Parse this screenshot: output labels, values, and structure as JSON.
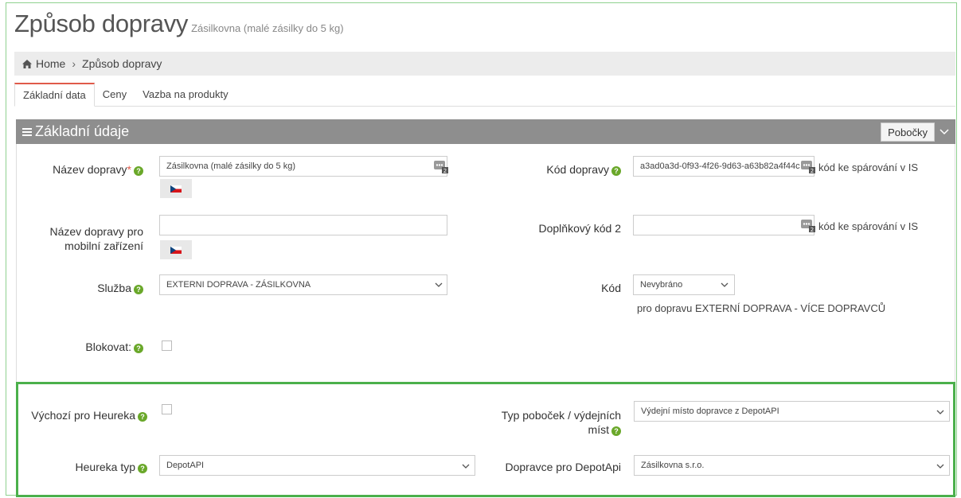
{
  "header": {
    "title": "Způsob dopravy",
    "subtitle": "Zásilkovna (malé zásilky do 5 kg)"
  },
  "breadcrumb": {
    "home": "Home",
    "current": "Způsob dopravy"
  },
  "tabs": [
    {
      "label": "Základní data",
      "active": true
    },
    {
      "label": "Ceny",
      "active": false
    },
    {
      "label": "Vazba na produkty",
      "active": false
    }
  ],
  "panel": {
    "title": "Základní údaje",
    "branches_button": "Pobočky"
  },
  "form": {
    "name": {
      "label": "Název dopravy",
      "required": "*",
      "value": "Zásilkovna (malé zásilky do 5 kg)"
    },
    "code": {
      "label": "Kód dopravy",
      "value": "a3ad0a3d-0f93-4f26-9d63-a63b82a4f44c",
      "hint": "kód ke spárování v IS"
    },
    "mobile_name": {
      "label_line1": "Název dopravy pro",
      "label_line2": "mobilní zařízení",
      "value": ""
    },
    "extra_code": {
      "label": "Doplňkový kód 2",
      "value": "",
      "hint": "kód ke spárování v IS"
    },
    "service": {
      "label": "Služba",
      "value": "EXTERNI DOPRAVA - ZÁSILKOVNA"
    },
    "kod": {
      "label": "Kód",
      "value": "Nevybráno",
      "note": "pro dopravu EXTERNÍ DOPRAVA - VÍCE DOPRAVCŮ"
    },
    "block": {
      "label": "Blokovat:",
      "checked": false
    },
    "heureka_default": {
      "label": "Výchozí pro Heureka",
      "checked": false
    },
    "branch_type": {
      "label_line1": "Typ poboček / výdejních",
      "label_line2": "míst",
      "value": "Výdejní místo dopravce z DepotAPI"
    },
    "heureka_type": {
      "label": "Heureka typ",
      "value": "DepotAPI"
    },
    "depot_carrier": {
      "label": "Dopravce pro DepotApi",
      "value": "Zásilkovna s.r.o."
    }
  },
  "icons": {
    "home": "home-icon",
    "list": "list-icon",
    "help": "?",
    "flag": "flag-cz-icon",
    "dots": "dots-icon",
    "chevron": "chevron-down-icon"
  },
  "colors": {
    "help_green": "#6aa82a",
    "highlight_border": "#4bb04b",
    "tab_accent": "#e05a4a",
    "panel_header": "#8e8e8e"
  }
}
